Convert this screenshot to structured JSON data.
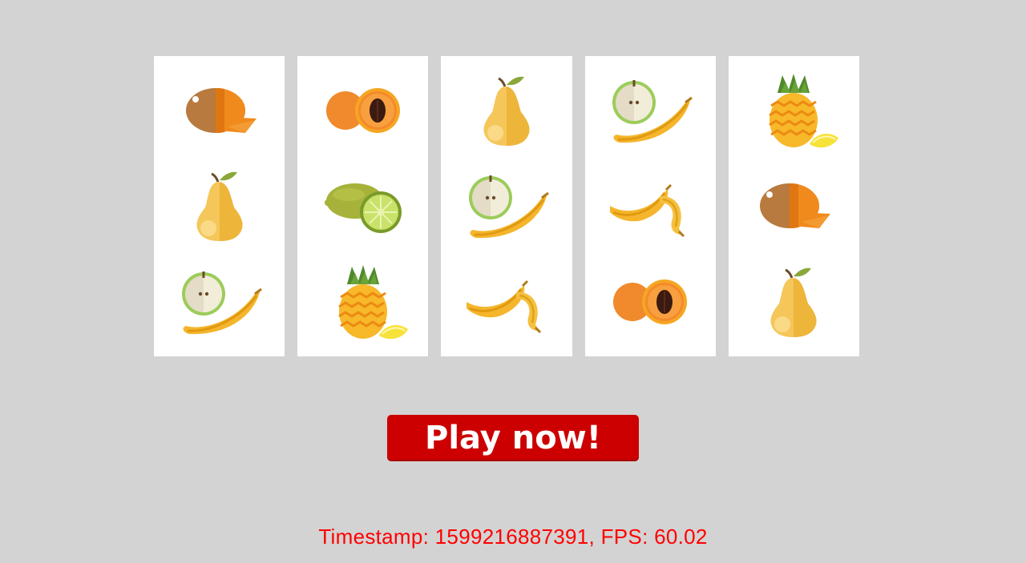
{
  "reels": [
    {
      "symbols": [
        "coconut",
        "pear",
        "apple-banana"
      ]
    },
    {
      "symbols": [
        "apricot",
        "lime",
        "pineapple"
      ]
    },
    {
      "symbols": [
        "pear",
        "apple-banana",
        "banana"
      ]
    },
    {
      "symbols": [
        "apple-banana",
        "banana",
        "apricot"
      ]
    },
    {
      "symbols": [
        "pineapple",
        "coconut",
        "pear"
      ]
    }
  ],
  "play_button": {
    "label": "Play now!",
    "color": "#cc0000"
  },
  "status": {
    "timestamp": "1599216887391",
    "fps": "60.02",
    "text": "Timestamp: 1599216887391, FPS: 60.02",
    "color": "#ff0000"
  },
  "background": "#d3d3d3"
}
